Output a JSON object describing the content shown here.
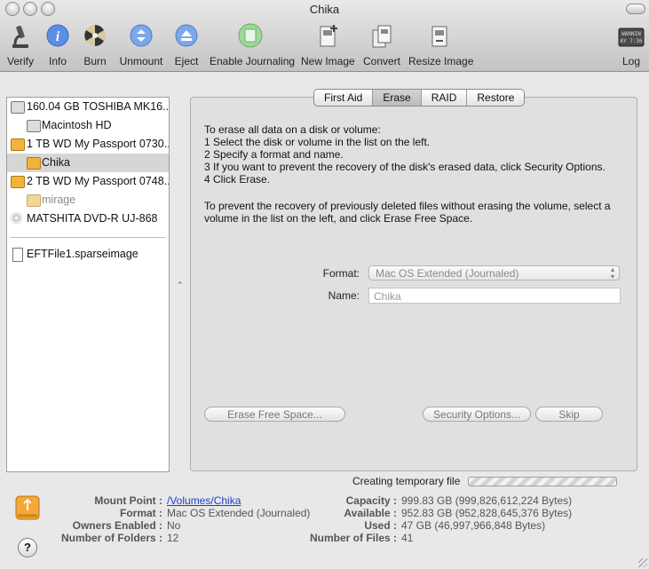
{
  "window": {
    "title": "Chika"
  },
  "toolbar": {
    "items": [
      {
        "label": "Verify",
        "icon": "microscope-icon"
      },
      {
        "label": "Info",
        "icon": "info-icon"
      },
      {
        "label": "Burn",
        "icon": "burn-icon"
      },
      {
        "label": "Unmount",
        "icon": "unmount-icon"
      },
      {
        "label": "Eject",
        "icon": "eject-icon"
      },
      {
        "label": "Enable Journaling",
        "icon": "journal-icon"
      },
      {
        "label": "New Image",
        "icon": "new-image-icon"
      },
      {
        "label": "Convert",
        "icon": "convert-icon"
      },
      {
        "label": "Resize Image",
        "icon": "resize-image-icon"
      },
      {
        "label": "Log",
        "icon": "log-icon",
        "badge_line1": "WARNIN",
        "badge_line2": "AY 7:36"
      }
    ]
  },
  "sidebar": {
    "items": [
      {
        "label": "160.04 GB TOSHIBA MK16...",
        "kind": "disk"
      },
      {
        "label": "Macintosh HD",
        "kind": "volume"
      },
      {
        "label": "1 TB WD My Passport 0730...",
        "kind": "ext-disk"
      },
      {
        "label": "Chika",
        "kind": "ext-volume",
        "selected": true
      },
      {
        "label": "2 TB WD My Passport 0748...",
        "kind": "ext-disk"
      },
      {
        "label": "mirage",
        "kind": "ext-volume-dim"
      },
      {
        "label": "MATSHITA DVD-R UJ-868",
        "kind": "optical"
      },
      {
        "label": "EFTFile1.sparseimage",
        "kind": "image"
      }
    ]
  },
  "tabs": [
    "First Aid",
    "Erase",
    "RAID",
    "Restore"
  ],
  "active_tab": "Erase",
  "erase": {
    "instructions": [
      "To erase all data on a disk or volume:",
      "1 Select the disk or volume in the list on the left.",
      "2 Specify a format and name.",
      "3 If you want to prevent the recovery of the disk's erased data, click Security Options.",
      "4 Click Erase."
    ],
    "free_space_text": "To prevent the recovery of previously deleted files without erasing the volume, select a volume in the list on the left, and click Erase Free Space.",
    "format_label": "Format:",
    "format_value": "Mac OS Extended (Journaled)",
    "name_label": "Name:",
    "name_value": "Chika",
    "erase_free_space_button": "Erase Free Space...",
    "security_options_button": "Security Options...",
    "skip_button": "Skip"
  },
  "status": {
    "text": "Creating temporary file"
  },
  "info": {
    "left": [
      {
        "key": "Mount Point :",
        "value": "/Volumes/Chika",
        "link": true
      },
      {
        "key": "Format :",
        "value": "Mac OS Extended (Journaled)"
      },
      {
        "key": "Owners Enabled :",
        "value": "No"
      },
      {
        "key": "Number of Folders :",
        "value": "12"
      }
    ],
    "right": [
      {
        "key": "Capacity :",
        "value": "999.83 GB (999,826,612,224 Bytes)"
      },
      {
        "key": "Available :",
        "value": "952.83 GB (952,828,645,376 Bytes)"
      },
      {
        "key": "Used :",
        "value": "47 GB (46,997,966,848 Bytes)"
      },
      {
        "key": "Number of Files :",
        "value": "41"
      }
    ]
  },
  "help": {
    "glyph": "?"
  }
}
